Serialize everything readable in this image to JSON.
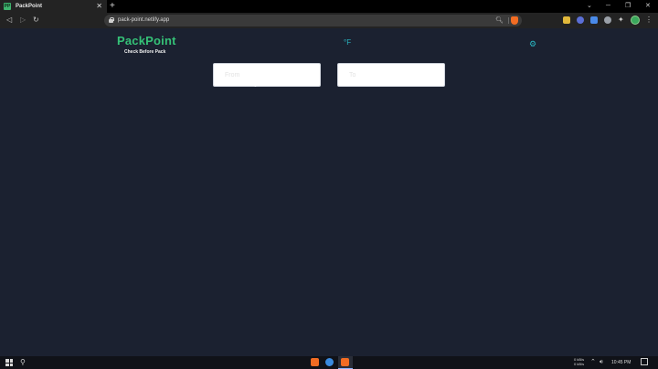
{
  "browser": {
    "tab": {
      "favicon": "PP",
      "title": "PackPoint"
    },
    "url": "pack-point.netlify.app"
  },
  "app": {
    "logo": "PackPoint",
    "tagline": "Check Before Pack",
    "unit_toggle": "°F",
    "theme_icon": "gear-icon"
  },
  "search": {
    "from_placeholder": "From",
    "to_placeholder": "To"
  },
  "taskbar": {
    "net_up": "0 kB/s",
    "net_down": "0 kB/s",
    "time": "10:45 PM"
  },
  "colors": {
    "page_bg": "#1b2130",
    "brand": "#35c177",
    "accent": "#2ab6c2"
  }
}
